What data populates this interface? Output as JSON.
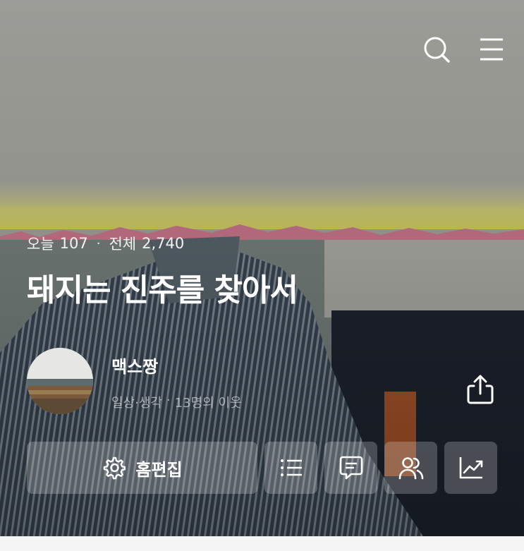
{
  "header": {
    "search_icon": "search-icon",
    "menu_icon": "hamburger-menu-icon"
  },
  "stats": {
    "today_label": "오늘",
    "today_value": "107",
    "separator": "·",
    "total_label": "전체",
    "total_value": "2,740"
  },
  "blog": {
    "title": "돼지는 진주를 찾아서"
  },
  "profile": {
    "nickname": "맥스짱",
    "category": "일상·생각",
    "separator": "·",
    "neighbors": "13명의 이웃"
  },
  "actions": {
    "edit_label": "홈편집",
    "edit_icon": "gear-icon",
    "list_icon": "list-icon",
    "comment_icon": "message-icon",
    "neighbors_icon": "people-icon",
    "stats_icon": "trend-chart-icon",
    "share_icon": "share-icon"
  },
  "colors": {
    "text_primary": "#ffffff",
    "button_bg": "rgba(255,255,255,0.22)"
  }
}
